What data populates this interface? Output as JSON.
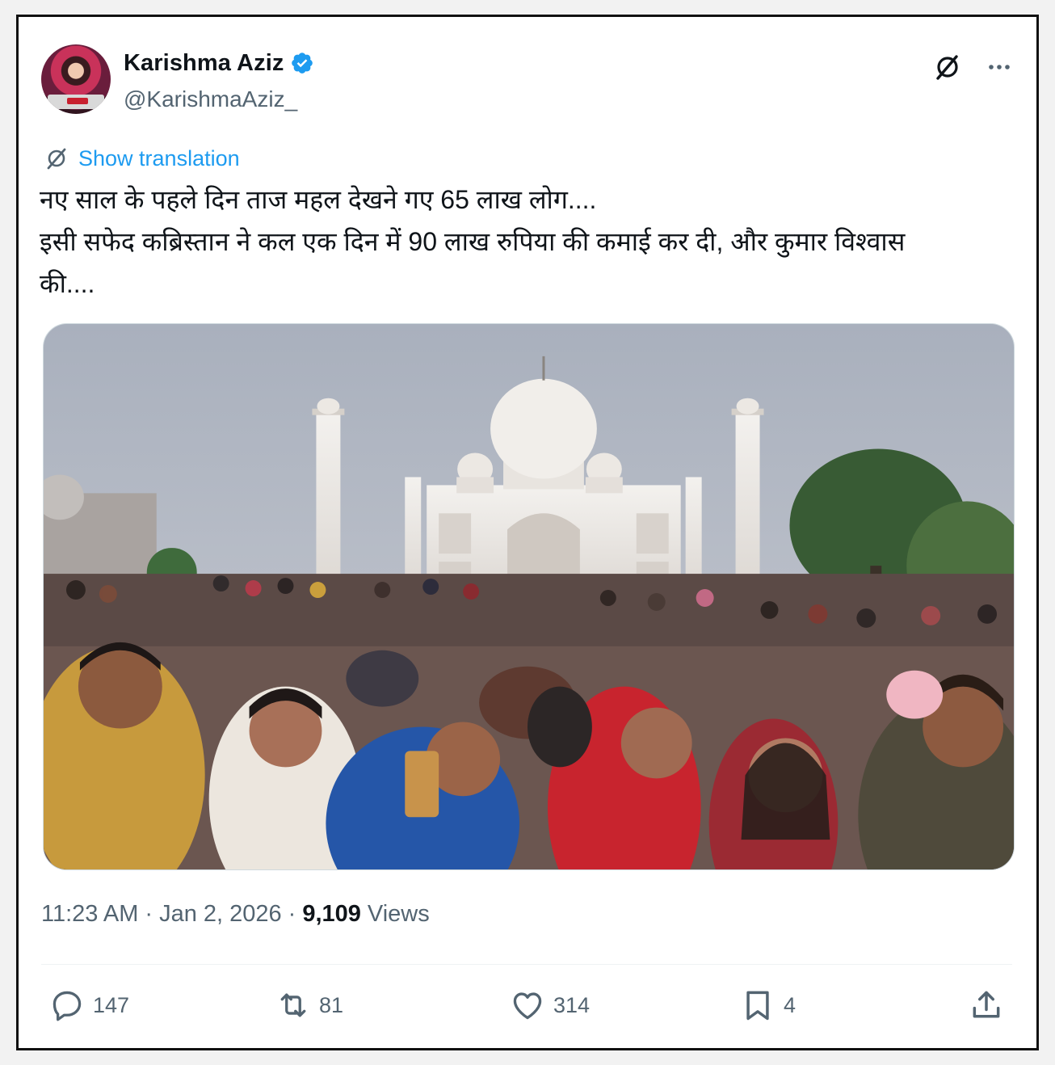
{
  "author": {
    "name": "Karishma Aziz",
    "handle": "@KarishmaAziz_",
    "verified": true,
    "avatar_icon": "profile-photo"
  },
  "translate_label": "Show translation",
  "tweet_lines": [
    "नए साल के पहले दिन ताज महल देखने गए 65 लाख लोग....",
    "इसी सफेद कब्रिस्तान ने कल एक दिन में 90 लाख रुपिया की कमाई कर दी, और कुमार विश्वास",
    "की...."
  ],
  "media": {
    "subject": "photo"
  },
  "meta": {
    "time": "11:23 AM",
    "separator": "·",
    "date": "Jan 2, 2026",
    "views_count": "9,109",
    "views_label": "Views"
  },
  "actions": {
    "replies": "147",
    "reposts": "81",
    "likes": "314",
    "bookmarks": "4"
  },
  "colors": {
    "link": "#1d9bf0",
    "secondary_text": "#536471",
    "primary_text": "#0f1419",
    "verified": "#1d9bf0"
  }
}
